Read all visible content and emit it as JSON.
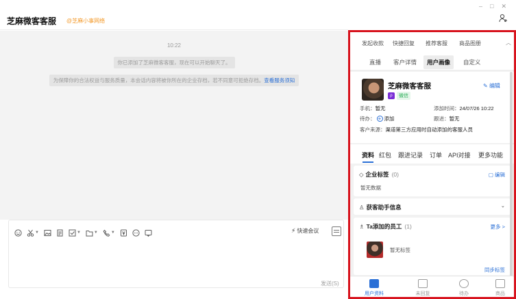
{
  "window": {
    "minimize": "–",
    "maximize": "□",
    "close": "✕"
  },
  "chat": {
    "title": "芝麻微客客服",
    "tag": "@芝麻小事网络",
    "time": "10:22",
    "system_msg_1": "你已添加了芝麻微客客服，现在可以开始聊天了。",
    "system_msg_2": "为保障你的合法权益与服务质量，本会话内容将被你所在的企业存档，若不同意可拒绝存档。",
    "system_msg_2_link": "查看服务须知",
    "quick_meeting": "快速会议",
    "send": "发送(S)"
  },
  "sidebar": {
    "tabs_row1": [
      "发起收款",
      "快捷回复",
      "推荐客服",
      "商品图册"
    ],
    "tabs_row2": [
      "直播",
      "客户详情",
      "用户画像",
      "自定义"
    ],
    "active_tab_row2": "用户画像",
    "profile": {
      "name": "芝麻微客客服",
      "badge": "微信",
      "edit": "编辑",
      "phone_label": "手机：",
      "phone_value": "暂无",
      "added_label": "添加时间：",
      "added_value": "24/07/26 10:22",
      "todo_label": "待办：",
      "todo_action": "添加",
      "follow_label": "跟进：",
      "follow_value": "暂无",
      "source_label": "客户来源：",
      "source_value": "渠道第三方应用时自动添加的客服人员"
    },
    "tabs_row3": [
      "资料",
      "红包",
      "跟进记录",
      "订单",
      "API对接",
      "更多功能"
    ],
    "active_tab_row3": "资料",
    "enterprise_tags": {
      "title": "企业标签",
      "count": "(0)",
      "action": "编辑",
      "empty": "暂无数据"
    },
    "acquisition": {
      "title": "获客助手信息"
    },
    "employees": {
      "title": "Ta添加的员工",
      "count": "(1)",
      "action": "更多 >",
      "tag": "暂无标签",
      "sync": "同步标签"
    },
    "bottom_nav": [
      "用户资料",
      "未回复",
      "待办",
      "商品"
    ],
    "active_nav": "用户资料"
  },
  "colors": {
    "accent": "#2a6fd6",
    "highlight_border": "#d7131d",
    "tag_orange": "#f39a2b",
    "wechat_green": "#2cae58"
  }
}
